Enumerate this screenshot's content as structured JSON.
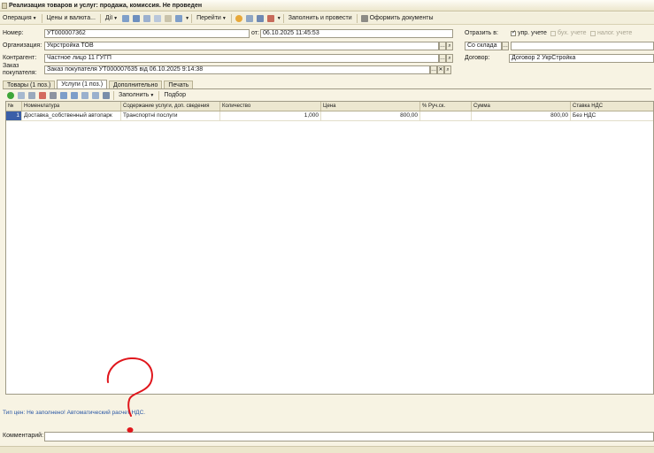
{
  "window": {
    "title": "Реализация товаров и услуг: продажа, комиссия. Не проведен"
  },
  "toolbar": {
    "operation": "Операция",
    "prices": "Цены и валюта...",
    "actions": "Дії",
    "goto": "Перейти",
    "fill_and_post": "Заполнить и провести",
    "create_docs": "Оформить документы"
  },
  "form": {
    "number_label": "Номер:",
    "number_value": "УТ000007362",
    "date_label": "от:",
    "date_value": "06.10.2025 11:45:53",
    "org_label": "Организация:",
    "org_value": "Укрстройка ТОВ",
    "contractor_label": "Контрагент:",
    "contractor_value": "Частное лицо 11 ГУГП",
    "order_label_1": "Заказ",
    "order_label_2": "покупателя:",
    "order_value": "Заказ покупателя УТ000007635 від 06.10.2025 9:14:38",
    "reflect_label": "Отразить в:",
    "check_mgmt_label": "упр. учете",
    "check_mgmt_checked": true,
    "check_acc_label": "бух. учете",
    "check_acc_checked": false,
    "check_tax_label": "налог. учете",
    "check_tax_checked": false,
    "warehouse_value": "Со склада",
    "contract_label": "Договор:",
    "contract_value": "Договор 2 УкрСтройка"
  },
  "tabs": [
    {
      "label": "Товары (1 поз.)",
      "active": false
    },
    {
      "label": "Услуги (1 поз.)",
      "active": true
    },
    {
      "label": "Дополнительно",
      "active": false
    },
    {
      "label": "Печать",
      "active": false
    }
  ],
  "subtoolbar": {
    "fill": "Заполнить",
    "select": "Подбор"
  },
  "table": {
    "columns": [
      "№",
      "Номенклатура",
      "Содержание услуги, доп. сведения",
      "Количество",
      "Цена",
      "% Руч.ск.",
      "Сумма",
      "Ставка НДС"
    ],
    "rows": [
      [
        "1",
        "Доставка_собственный автопарк",
        "Транспортні послуги",
        "1,000",
        "800,00",
        "",
        "800,00",
        "Без НДС"
      ]
    ]
  },
  "status_text": "Тип цен: Не заполнено! Автоматический расчет НДС.",
  "comment": {
    "label": "Комментарий:",
    "value": ""
  },
  "colors": {
    "background": "#f7f3e3",
    "selected_row": "#3a5fa8",
    "status_link": "#2a57a5",
    "drawing_red": "#e0161c"
  }
}
